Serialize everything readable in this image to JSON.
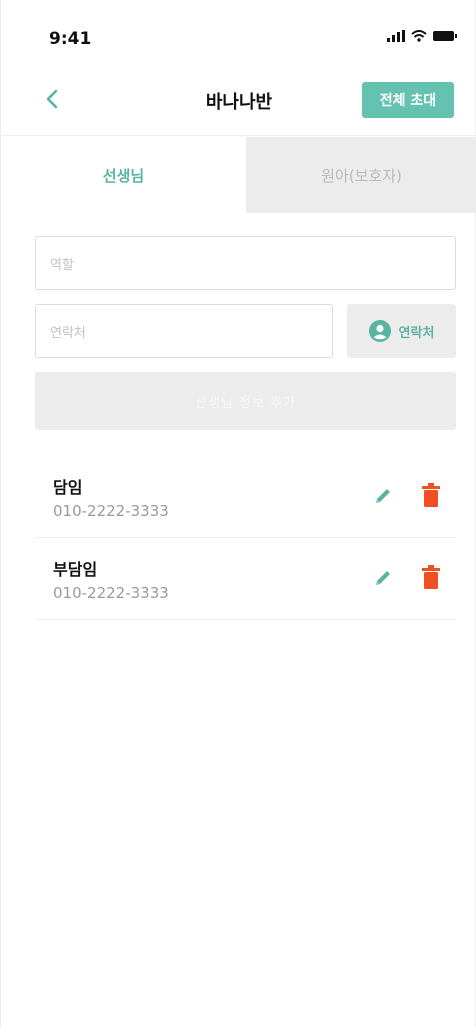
{
  "status_bar": {
    "time": "9:41",
    "icons": [
      "signal-icon",
      "wifi-icon",
      "battery-icon"
    ]
  },
  "header": {
    "back_icon": "chevron-left-icon",
    "title": "바나나반",
    "invite_all_label": "전체 초대"
  },
  "tabs": [
    {
      "label": "선생님",
      "active": true
    },
    {
      "label": "원아(보호자)",
      "active": false
    }
  ],
  "form": {
    "role_placeholder": "역할",
    "contact_placeholder": "연락처",
    "contacts_button_label": "연락처",
    "contacts_button_icon": "person-circle-icon",
    "add_button_label": "선생님 정보 추가"
  },
  "teachers": [
    {
      "role": "담임",
      "phone": "010-2222-3333"
    },
    {
      "role": "부담임",
      "phone": "010-2222-3333"
    }
  ],
  "colors": {
    "accent": "#5bb3a2",
    "button": "#66c2b0",
    "delete": "#f04e23",
    "disabled": "#ececec"
  }
}
